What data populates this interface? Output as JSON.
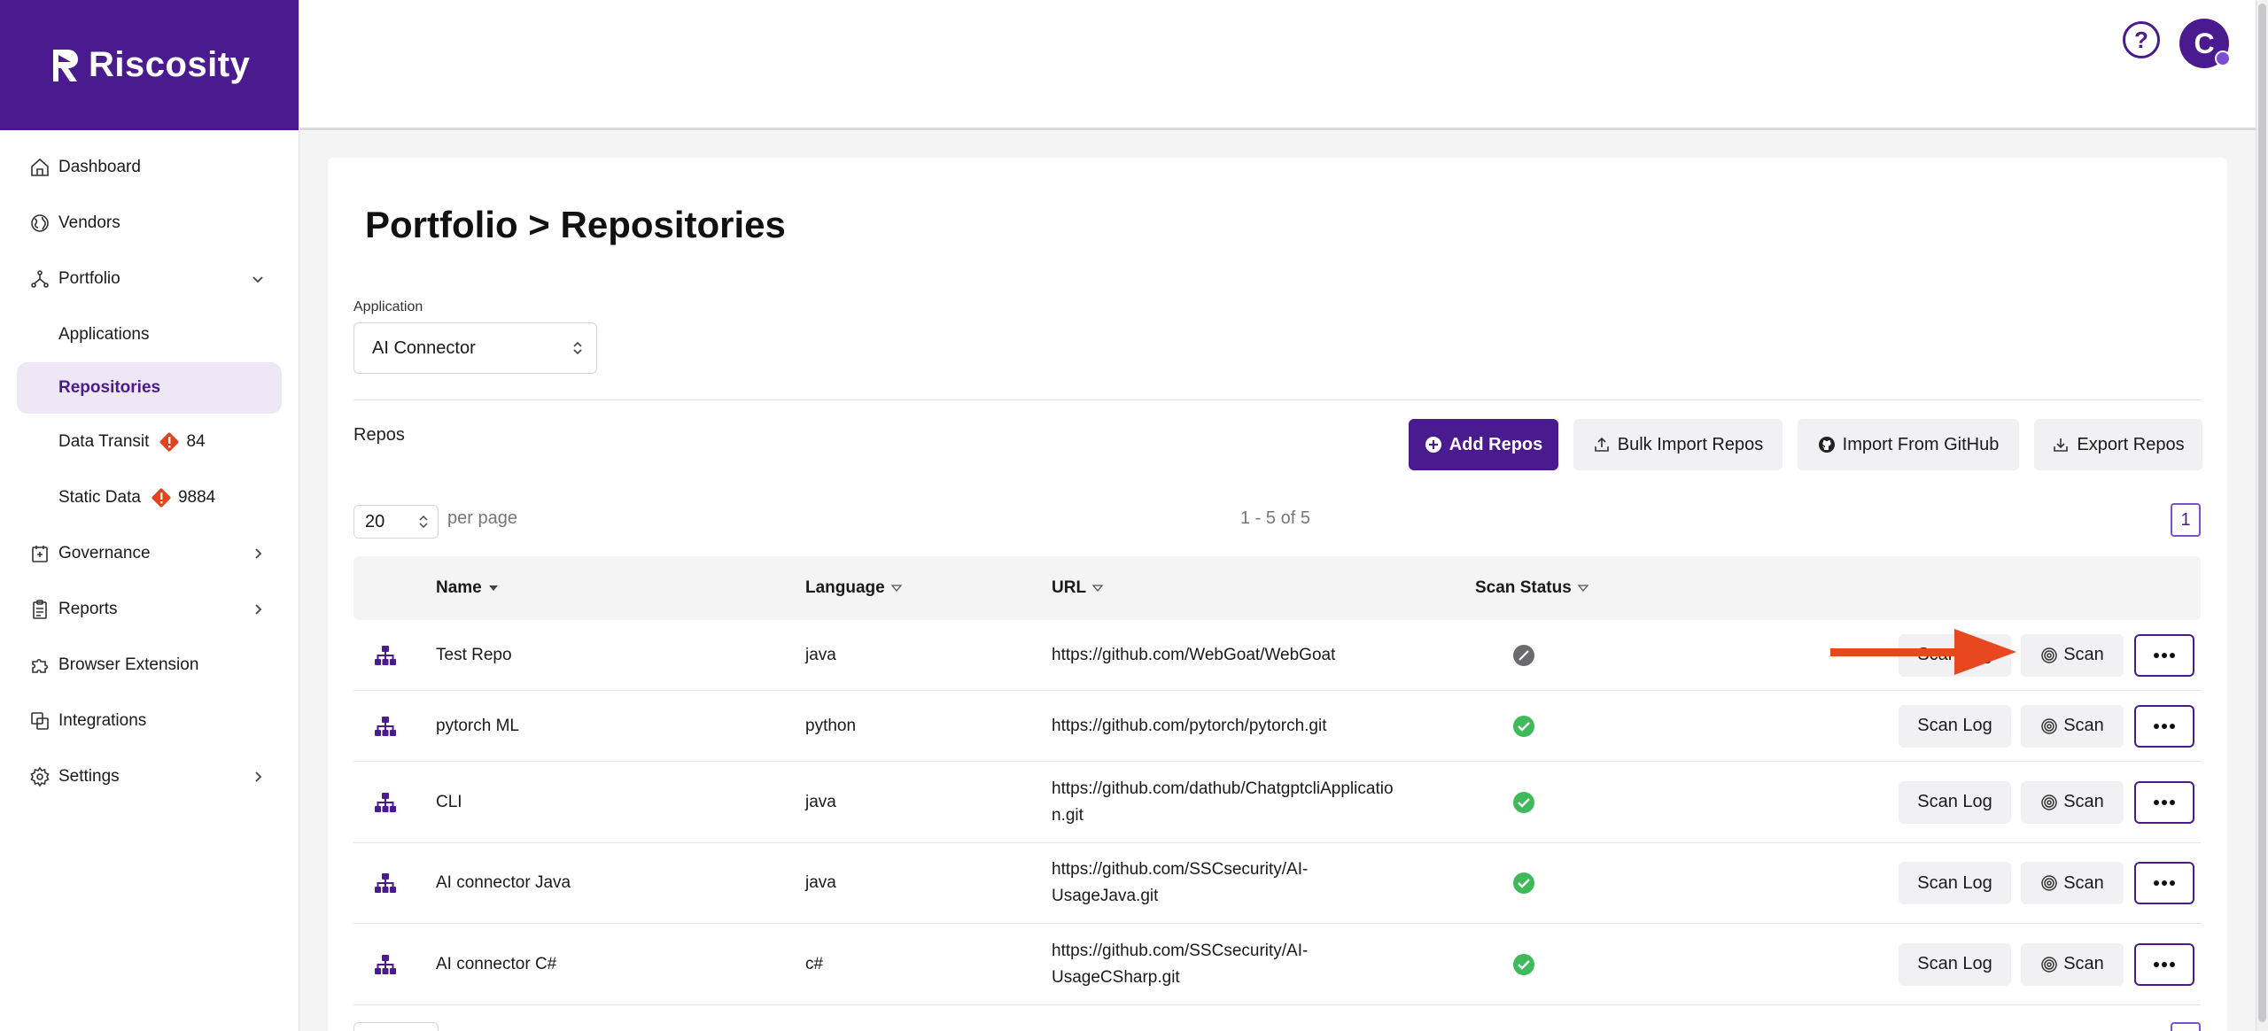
{
  "brand": {
    "name": "Riscosity",
    "color": "#4a1a8f"
  },
  "sidebar": {
    "items": [
      {
        "label": "Dashboard",
        "icon": "home-icon"
      },
      {
        "label": "Vendors",
        "icon": "globe-icon"
      },
      {
        "label": "Portfolio",
        "icon": "portfolio-icon",
        "expanded": true
      },
      {
        "label": "Applications"
      },
      {
        "label": "Repositories",
        "active": true
      },
      {
        "label": "Data Transit",
        "badge": "84"
      },
      {
        "label": "Static Data",
        "badge": "9884"
      },
      {
        "label": "Governance",
        "icon": "governance-icon"
      },
      {
        "label": "Reports",
        "icon": "clipboard-icon"
      },
      {
        "label": "Browser Extension",
        "icon": "puzzle-icon"
      },
      {
        "label": "Integrations",
        "icon": "integrations-icon"
      },
      {
        "label": "Settings",
        "icon": "gear-icon"
      }
    ]
  },
  "topbar": {
    "help_label": "?",
    "avatar_initial": "C"
  },
  "page": {
    "title": "Portfolio > Repositories",
    "application_label": "Application",
    "application_value": "AI Connector",
    "repos_label": "Repos",
    "buttons": {
      "add": "Add Repos",
      "bulk": "Bulk Import Repos",
      "github": "Import From GitHub",
      "export": "Export Repos"
    },
    "per_page_value": "20",
    "per_page_label": "per page",
    "range_text": "1 - 5 of 5",
    "current_page": "1"
  },
  "table": {
    "headers": {
      "name": "Name",
      "language": "Language",
      "url": "URL",
      "status": "Scan Status"
    },
    "rows": [
      {
        "name": "Test Repo",
        "language": "java",
        "url": "https://github.com/WebGoat/WebGoat",
        "status": "not-scanned",
        "log": "Scan Log",
        "scan": "Scan"
      },
      {
        "name": "pytorch ML",
        "language": "python",
        "url": "https://github.com/pytorch/pytorch.git",
        "status": "success",
        "log": "Scan Log",
        "scan": "Scan"
      },
      {
        "name": "CLI",
        "language": "java",
        "url": "https://github.com/dathub/ChatgptcliApplication.git",
        "status": "success",
        "log": "Scan Log",
        "scan": "Scan"
      },
      {
        "name": "AI connector Java",
        "language": "java",
        "url": "https://github.com/SSCsecurity/AI-UsageJava.git",
        "status": "success",
        "log": "Scan Log",
        "scan": "Scan"
      },
      {
        "name": "AI connector C#",
        "language": "c#",
        "url": "https://github.com/SSCsecurity/AI-UsageCSharp.git",
        "status": "success",
        "log": "Scan Log",
        "scan": "Scan"
      }
    ]
  },
  "colors": {
    "success": "#3fba5b",
    "neutral": "#6b6b6e",
    "warning": "#e3431f",
    "annotation": "#e8481f"
  }
}
